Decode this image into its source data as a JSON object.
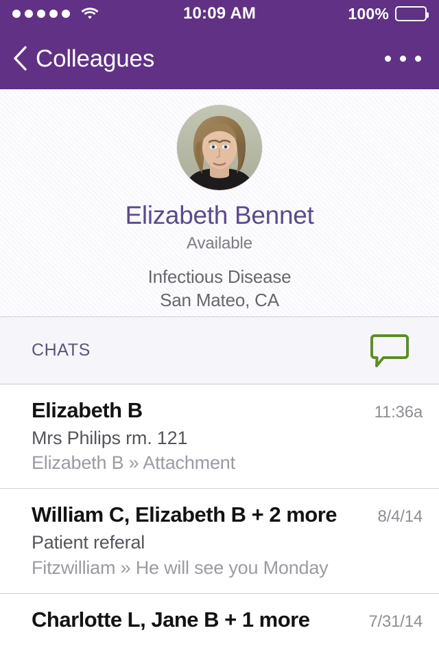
{
  "status_bar": {
    "signal_dots": 5,
    "wifi_icon": "wifi-icon",
    "time": "10:09 AM",
    "battery_percent": "100%",
    "battery_level": 100
  },
  "nav_bar": {
    "back_icon": "chevron-left-icon",
    "title": "Colleagues",
    "more_icon": "more-horizontal-icon"
  },
  "profile": {
    "avatar_alt": "Elizabeth Bennet profile photo",
    "name": "Elizabeth Bennet",
    "status": "Available",
    "specialty": "Infectious Disease",
    "location": "San Mateo, CA"
  },
  "chats_section": {
    "title": "CHATS",
    "compose_icon": "chat-bubble-icon"
  },
  "chats": [
    {
      "name": "Elizabeth B",
      "time": "11:36a",
      "subject": "Mrs Philips rm. 121",
      "preview": "Elizabeth B » Attachment"
    },
    {
      "name": "William C, Elizabeth B + 2 more",
      "time": "8/4/14",
      "subject": "Patient referal",
      "preview": "Fitzwilliam » He will see you Monday"
    },
    {
      "name": "Charlotte L, Jane B + 1 more",
      "time": "7/31/14",
      "subject": "",
      "preview": ""
    }
  ],
  "colors": {
    "brand_purple": "#603184",
    "name_purple": "#5b4a8a",
    "section_purple": "#59557e",
    "accent_green": "#5e8c28",
    "text_dark": "#131313",
    "text_mid": "#55555c",
    "text_light": "#9a9aa2",
    "time_gray": "#8e8e94"
  }
}
